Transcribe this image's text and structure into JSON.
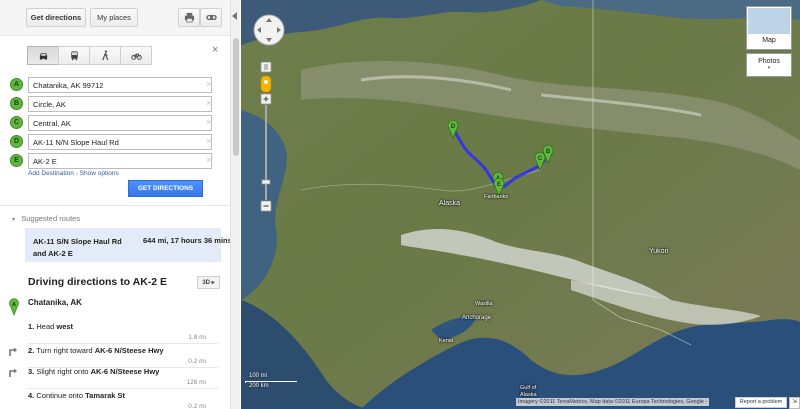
{
  "toolbar": {
    "get_directions": "Get directions",
    "my_places": "My places",
    "print_icon": "printer-icon",
    "link_icon": "link-icon"
  },
  "travel_modes": [
    {
      "name": "car-icon",
      "active": true
    },
    {
      "name": "bus-icon",
      "active": false
    },
    {
      "name": "walk-icon",
      "active": false
    },
    {
      "name": "bike-icon",
      "active": false
    }
  ],
  "close_label": "×",
  "destinations": [
    {
      "marker": "A",
      "value": "Chatanika, AK 99712"
    },
    {
      "marker": "B",
      "value": "Circle, AK"
    },
    {
      "marker": "C",
      "value": "Central, AK"
    },
    {
      "marker": "D",
      "value": "AK-11 N/N Slope Haul Rd"
    },
    {
      "marker": "E",
      "value": "AK-2 E"
    }
  ],
  "remove_label": "×",
  "add_destination": "Add Destination",
  "link_separator": " - ",
  "show_options": "Show options",
  "get_directions_button": "GET DIRECTIONS",
  "suggested_header": "Suggested routes",
  "suggested_route": {
    "name": "AK-11 S/N Slope Haul Rd and AK-2 E",
    "distance_time": "644 mi, 17 hours 36 mins"
  },
  "driving_title": "Driving directions to AK-2 E",
  "btn_3d": "3D ▸",
  "start": {
    "marker": "A",
    "name": "Chatanika, AK"
  },
  "steps": [
    {
      "num": "1.",
      "text": "Head ",
      "bold": "west",
      "dist": "1.8 mi",
      "turn": ""
    },
    {
      "num": "2.",
      "text": "Turn right toward ",
      "bold": "AK-6 N/Steese Hwy",
      "dist": "0.2 mi",
      "turn": "turn-right-icon"
    },
    {
      "num": "3.",
      "text": "Slight right onto ",
      "bold": "AK-6 N/Steese Hwy",
      "dist": "126 mi",
      "turn": "slight-right-icon"
    },
    {
      "num": "4.",
      "text": "Continue onto ",
      "bold": "Tamarak St",
      "dist": "0.2 mi",
      "turn": ""
    }
  ],
  "map": {
    "map_button": "Map",
    "photos_button": "Photos",
    "places": [
      {
        "name": "Alaska",
        "key": "alaska"
      },
      {
        "name": "Fairbanks",
        "key": "fairbanks"
      },
      {
        "name": "Yukon",
        "key": "yukon"
      },
      {
        "name": "Anchorage",
        "key": "anchorage"
      },
      {
        "name": "Wasilla",
        "key": "wasilla"
      },
      {
        "name": "Kenai",
        "key": "kenai"
      },
      {
        "name": "Gulf of Alaska",
        "key": "gulf"
      }
    ],
    "scale_mi": "100 mi",
    "scale_km": "200 km",
    "copyright": "Imagery ©2011 TerraMetrics, Map data ©2011 Europa Technologies, Google -",
    "report": "Report a problem",
    "route_color": "#2a2aff",
    "marker_color": "#5fb73e"
  }
}
